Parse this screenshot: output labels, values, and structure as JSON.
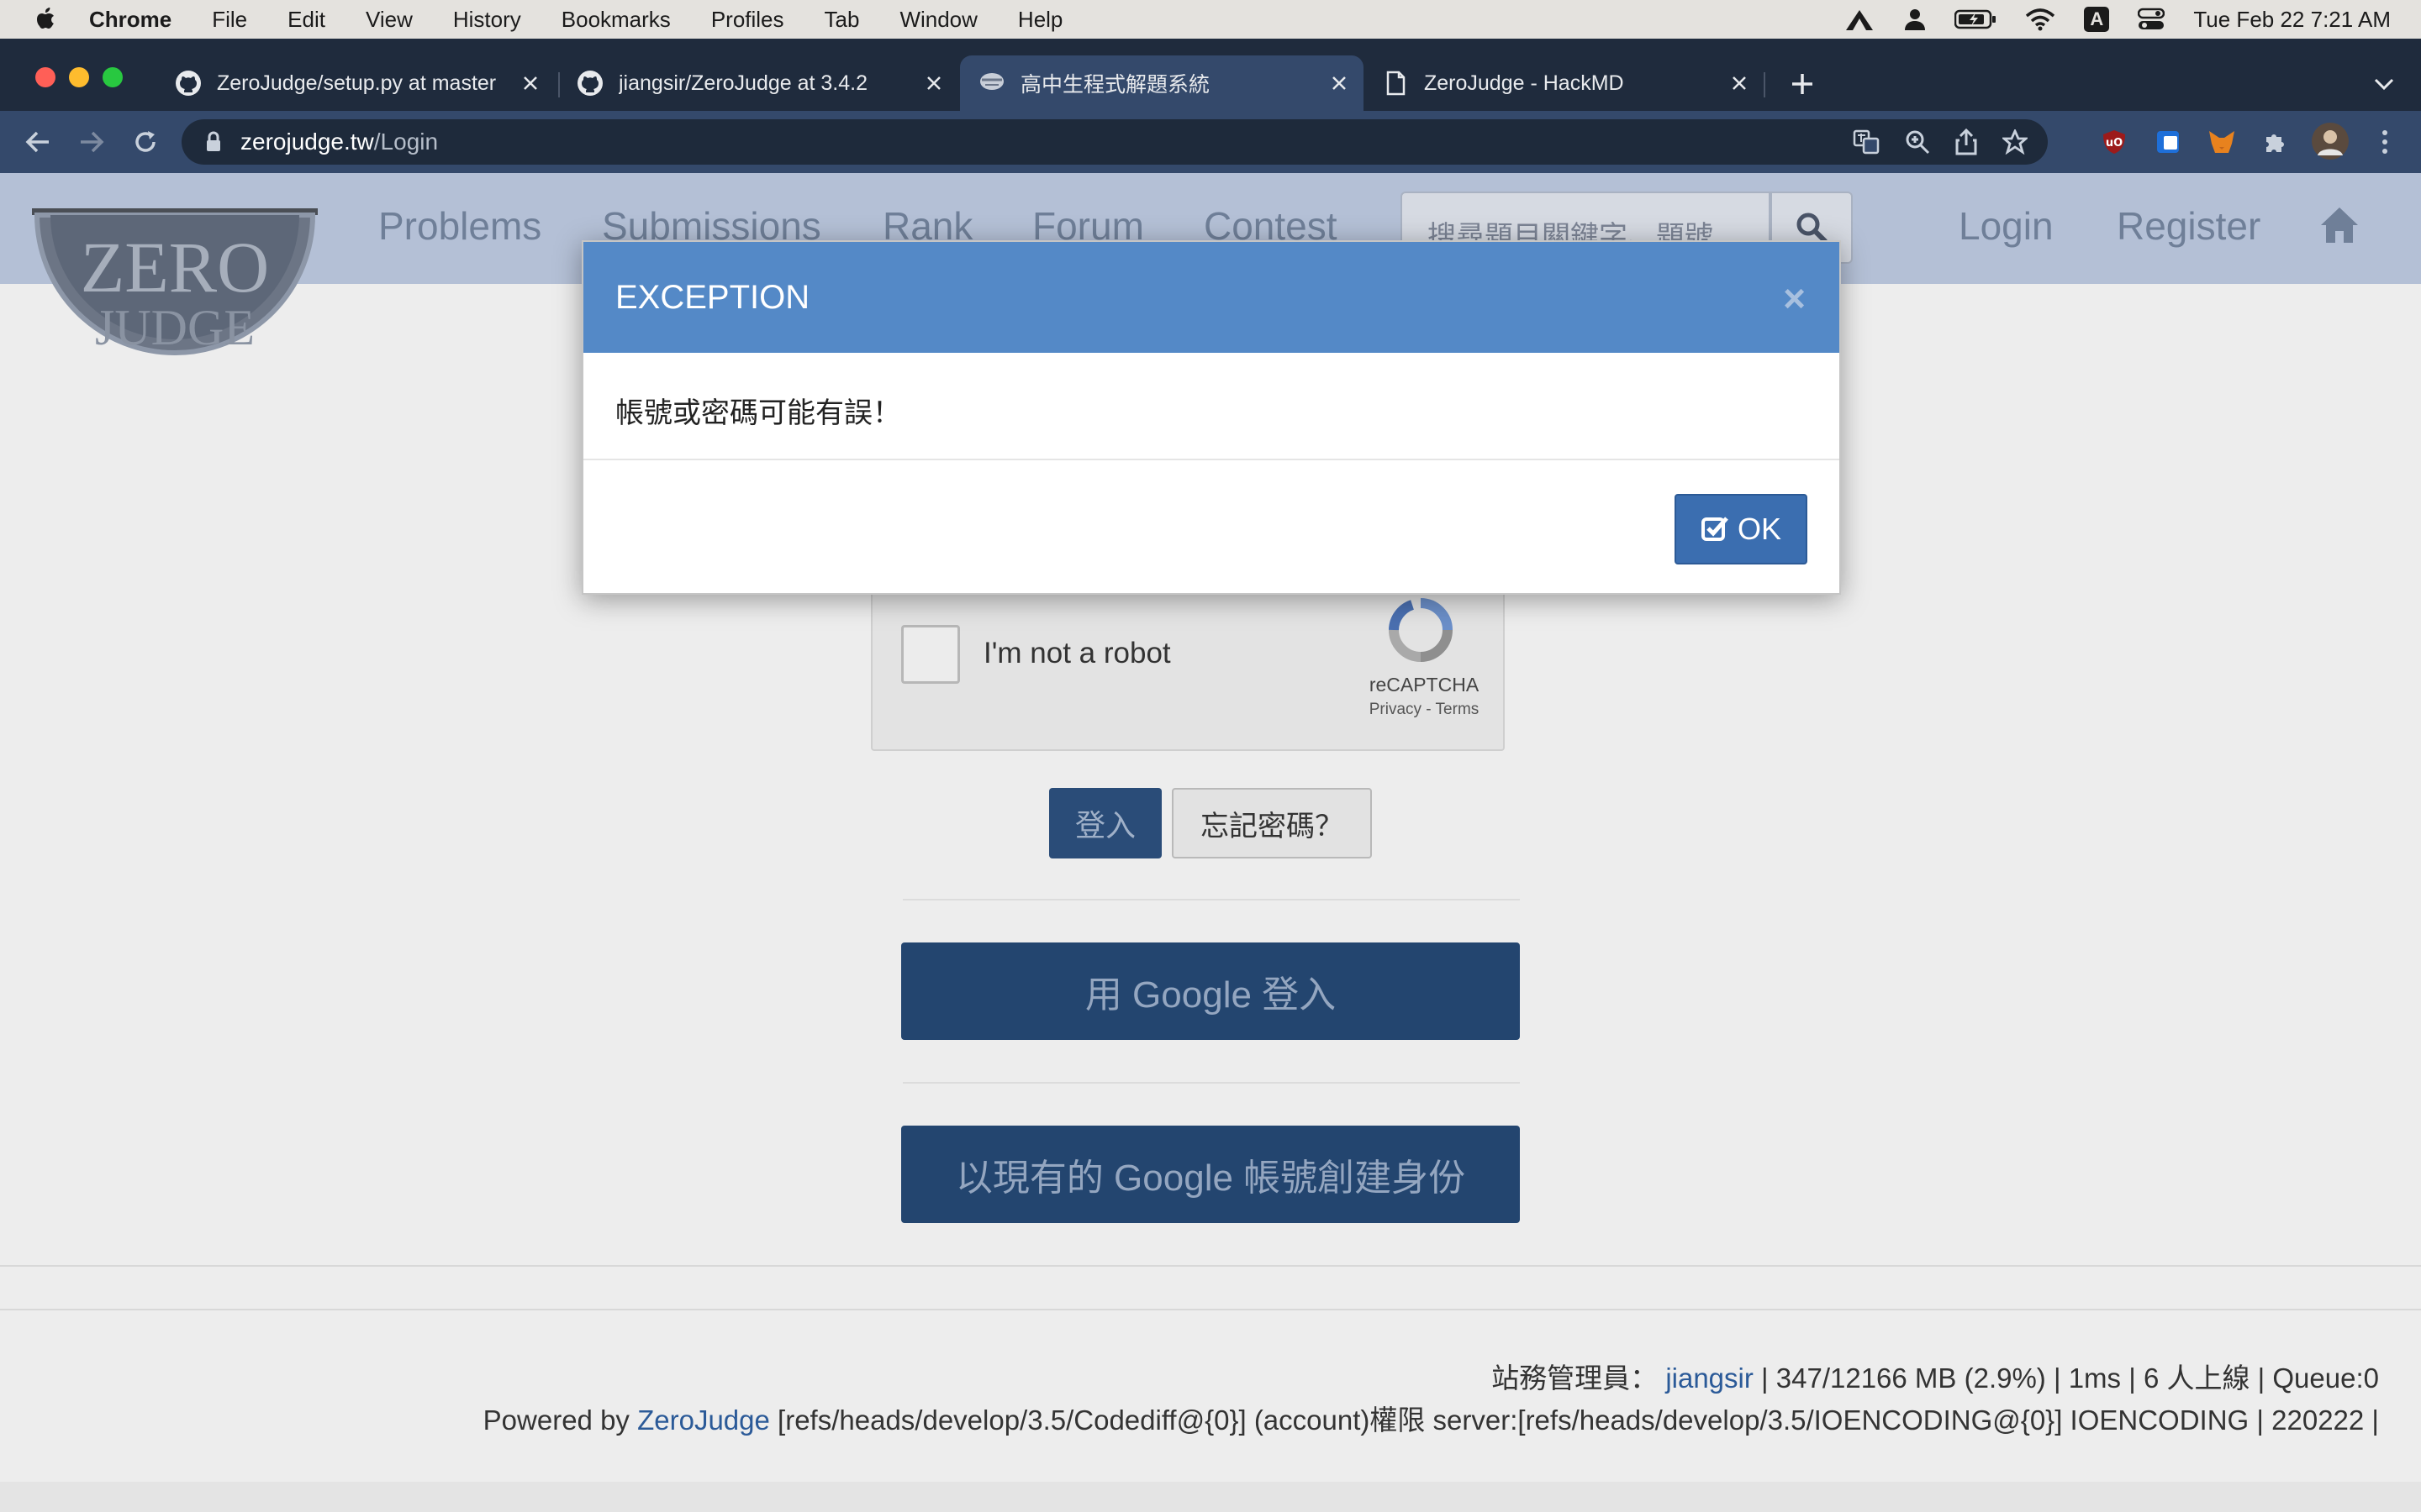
{
  "menubar": {
    "app": "Chrome",
    "items": [
      "File",
      "Edit",
      "View",
      "History",
      "Bookmarks",
      "Profiles",
      "Tab",
      "Window",
      "Help"
    ],
    "datetime": "Tue Feb 22  7:21 AM",
    "input_indicator": "A"
  },
  "tabs": [
    {
      "title": "ZeroJudge/setup.py at master",
      "icon": "github-icon"
    },
    {
      "title": "jiangsir/ZeroJudge at 3.4.2",
      "icon": "github-icon"
    },
    {
      "title": "高中生程式解題系統",
      "icon": "zerojudge-icon",
      "active": true
    },
    {
      "title": "ZeroJudge - HackMD",
      "icon": "document-icon"
    }
  ],
  "address": {
    "host": "zerojudge.tw",
    "path": "/Login"
  },
  "nav": {
    "links": [
      "Problems",
      "Submissions",
      "Rank",
      "Forum",
      "Contest"
    ],
    "search_placeholder": "搜尋題目關鍵字、題號...",
    "login": "Login",
    "register": "Register",
    "logo_top": "ZERO",
    "logo_bottom": "JUDGE"
  },
  "captcha": {
    "label": "I'm not a robot",
    "brand": "reCAPTCHA",
    "terms": "Privacy - Terms"
  },
  "form": {
    "login_button": "登入",
    "forgot_button": "忘記密碼？",
    "google_login": "用 Google 登入",
    "google_create": "以現有的 Google 帳號創建身份"
  },
  "footer": {
    "admin_label": "站務管理員：",
    "admin_name": "jiangsir",
    "stats": "| 347/12166 MB (2.9%) | 1ms | 6 人上線 | Queue:0",
    "powered_prefix": "Powered by",
    "powered_name": "ZeroJudge",
    "powered_suffix": "[refs/heads/develop/3.5/Codediff@{0}] (account)權限 server:[refs/heads/develop/3.5/IOENCODING@{0}] IOENCODING | 220222 |"
  },
  "modal": {
    "title": "EXCEPTION",
    "close": "×",
    "message": "帳號或密碼可能有誤！",
    "ok": "OK"
  },
  "colors": {
    "modal_header": "#5489c7",
    "primary_button": "#3b6eb0",
    "tabstrip": "#1f2b3d",
    "toolbar": "#34496b"
  }
}
